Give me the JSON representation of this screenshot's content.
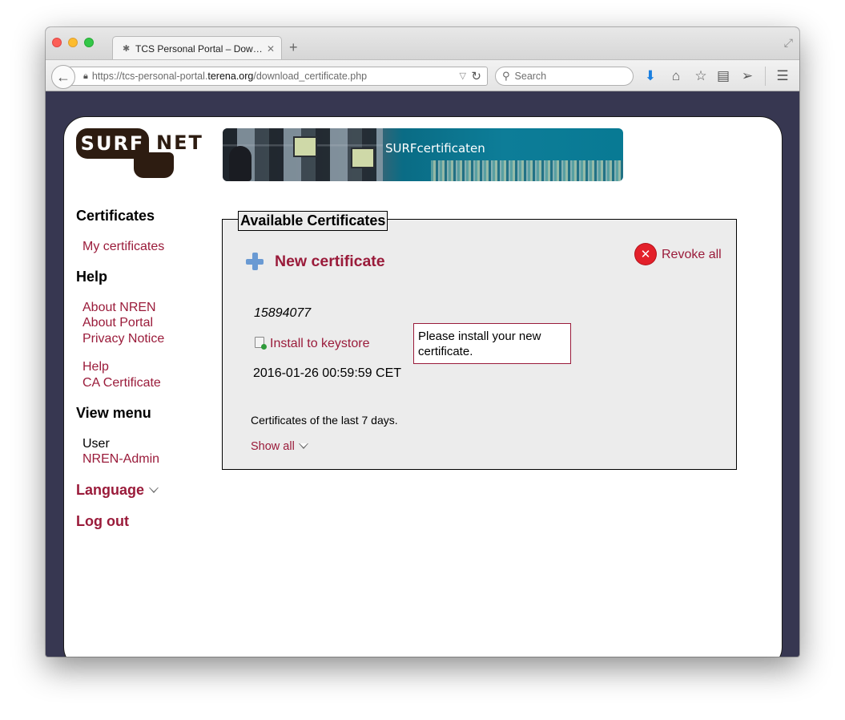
{
  "browser": {
    "tab_title": "TCS Personal Portal – Dow…",
    "tab_favicon": "gear-icon",
    "url_prefix": "https://tcs-personal-portal.",
    "url_domain": "terena.org",
    "url_path": "/download_certificate.php",
    "search_placeholder": "Search"
  },
  "header": {
    "logo_left": "SURF",
    "logo_right": "NET",
    "banner_title": "SURFcertificaten"
  },
  "sidebar": {
    "certificates_heading": "Certificates",
    "my_certificates": "My certificates",
    "help_heading": "Help",
    "about_nren": "About NREN",
    "about_portal": "About Portal",
    "privacy_notice": "Privacy Notice",
    "help_link": "Help",
    "ca_certificate": "CA Certificate",
    "view_menu_heading": "View menu",
    "user": "User",
    "nren_admin": "NREN-Admin",
    "language": "Language",
    "log_out": "Log out"
  },
  "main": {
    "legend": "Available Certificates",
    "new_certificate": "New certificate",
    "revoke_all": "Revoke all",
    "certificate_id": "15894077",
    "install_to_keystore": "Install to keystore",
    "install_tooltip": "Please install your new certificate.",
    "certificate_date": "2016-01-26 00:59:59 CET",
    "period_note": "Certificates of the last 7 days.",
    "show_all": "Show all"
  },
  "colors": {
    "link": "#9a1b3a",
    "page_frame": "#373751",
    "panel_bg": "#ececec"
  }
}
